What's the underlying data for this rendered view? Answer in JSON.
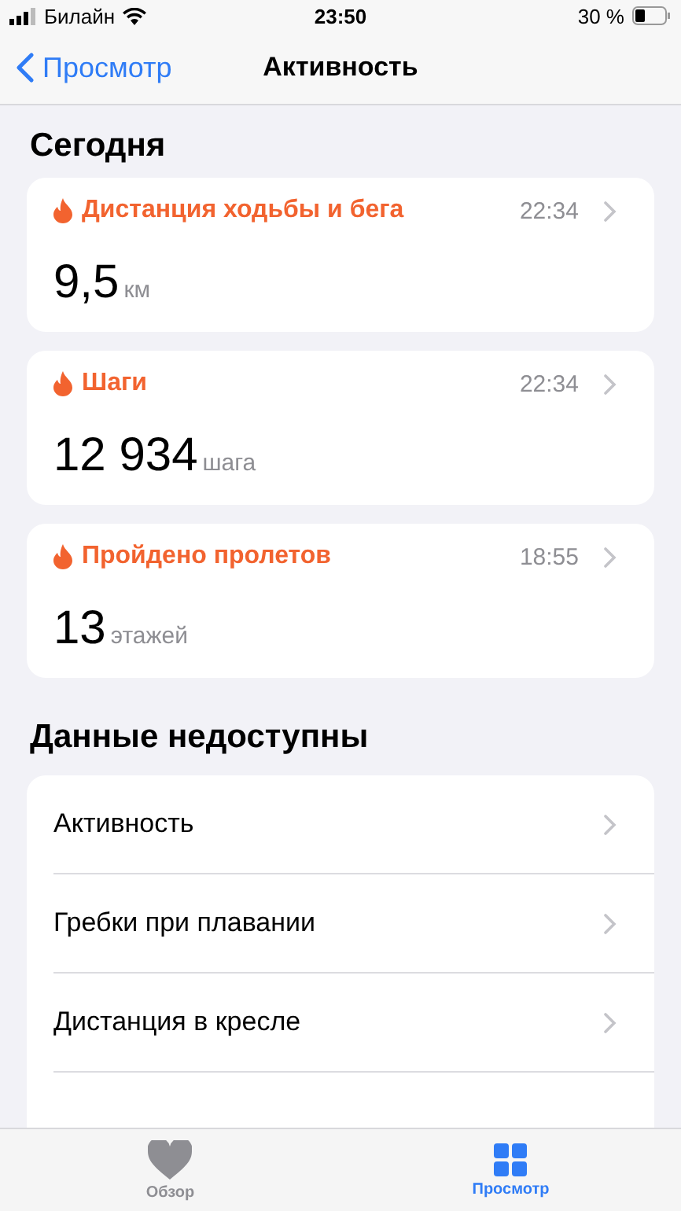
{
  "status_bar": {
    "carrier": "Билайн",
    "time": "23:50",
    "battery": "30 %"
  },
  "nav": {
    "back": "Просмотр",
    "title": "Активность"
  },
  "today": {
    "heading": "Сегодня",
    "cards": [
      {
        "title": "Дистанция ходьбы и бега",
        "time": "22:34",
        "value": "9,5",
        "unit": "км"
      },
      {
        "title": "Шаги",
        "time": "22:34",
        "value": "12 934",
        "unit": "шага"
      },
      {
        "title": "Пройдено пролетов",
        "time": "18:55",
        "value": "13",
        "unit": "этажей"
      }
    ]
  },
  "unavailable": {
    "heading": "Данные недоступны",
    "items": [
      {
        "label": "Активность"
      },
      {
        "label": "Гребки при плавании"
      },
      {
        "label": "Дистанция в кресле"
      }
    ]
  },
  "tab_bar": {
    "tabs": [
      {
        "kind": "heart",
        "label": "Обзор",
        "selected": false
      },
      {
        "kind": "grid",
        "label": "Просмотр",
        "selected": true
      }
    ]
  }
}
